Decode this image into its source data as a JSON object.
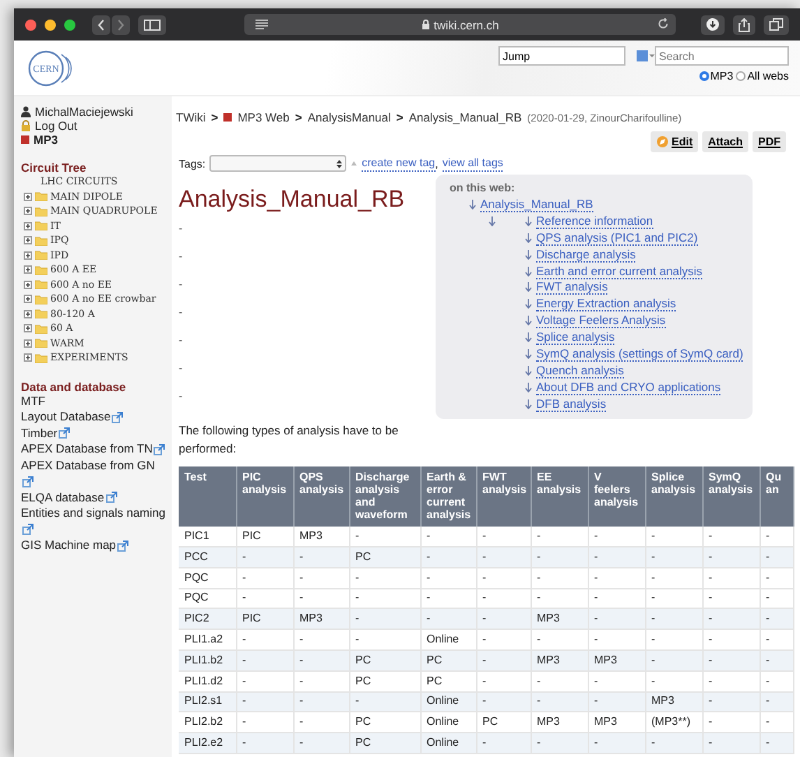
{
  "browser": {
    "url": "twiki.cern.ch"
  },
  "header": {
    "logo_text": "CERN",
    "jump": {
      "value": "Jump"
    },
    "search": {
      "placeholder": "Search"
    },
    "scopes": [
      {
        "label": "MP3",
        "selected": true
      },
      {
        "label": "All webs",
        "selected": false
      }
    ]
  },
  "sidebar": {
    "user_links": [
      {
        "label": "MichalMaciejewski",
        "kind": "user"
      },
      {
        "label": "Log Out",
        "kind": "lock"
      },
      {
        "label": "MP3",
        "kind": "web"
      }
    ],
    "circuit_tree": {
      "title": "Circuit Tree",
      "root": {
        "label": "LHC CIRCUITS",
        "children": [
          {
            "label": "MAIN DIPOLE",
            "expanded": false
          },
          {
            "label": "MAIN QUADRUPOLE",
            "expanded": false
          },
          {
            "label": "IT",
            "expanded": false
          },
          {
            "label": "IPQ",
            "expanded": false
          },
          {
            "label": "IPD",
            "expanded": false
          },
          {
            "label": "600 A EE",
            "expanded": false
          },
          {
            "label": "600 A no EE",
            "expanded": false
          },
          {
            "label": "600 A no EE crowbar",
            "expanded": false
          },
          {
            "label": "80-120 A",
            "expanded": false
          },
          {
            "label": "60 A",
            "expanded": false
          },
          {
            "label": "WARM",
            "expanded": false
          },
          {
            "label": "EXPERIMENTS",
            "expanded": false
          }
        ]
      }
    },
    "data_section": {
      "title": "Data and database",
      "links": [
        {
          "label": "MTF",
          "external": false
        },
        {
          "label": "Layout Database",
          "external": true
        },
        {
          "label": "Timber",
          "external": true
        },
        {
          "label": "APEX Database from TN",
          "external": true
        },
        {
          "label": "APEX Database from GN",
          "external": true
        },
        {
          "label": "ELQA database",
          "external": true
        },
        {
          "label": "Entities and signals naming",
          "external": true
        },
        {
          "label": "GIS Machine map",
          "external": true
        }
      ]
    }
  },
  "breadcrumb": {
    "items": [
      "TWiki",
      "MP3 Web",
      "AnalysisManual",
      "Analysis_Manual_RB"
    ],
    "separator": ">",
    "meta": "(2020-01-29, ZinourCharifoulline)"
  },
  "actions": [
    "Edit",
    "Attach",
    "PDF"
  ],
  "tags": {
    "label": "Tags:",
    "links": [
      "create new tag",
      "view all tags"
    ],
    "separator": ","
  },
  "title": "Analysis_Manual_RB",
  "bullets": [
    "-",
    "-",
    "-",
    "-",
    "-",
    "-",
    "-"
  ],
  "toc": {
    "heading": "on this web:",
    "root": "Analysis_Manual_RB",
    "items": [
      "Reference information",
      "QPS analysis (PIC1 and PIC2)",
      "Discharge analysis",
      "Earth and error current analysis",
      "FWT analysis",
      "Energy Extraction analysis",
      "Voltage Feelers Analysis",
      "Splice analysis",
      "SymQ analysis (settings of SymQ card)",
      "Quench analysis",
      "About DFB and CRYO applications",
      "DFB analysis"
    ]
  },
  "intro": "The following types of analysis have to be performed:",
  "table": {
    "columns": [
      "Test",
      "PIC analysis",
      "QPS analysis",
      "Discharge analysis and waveform",
      "Earth & error current analysis",
      "FWT analysis",
      "EE analysis",
      "V feelers analysis",
      "Splice analysis",
      "SymQ analysis",
      "Qu an"
    ],
    "rows": [
      {
        "shaded": false,
        "cells": [
          "PIC1",
          "PIC",
          "MP3",
          "-",
          "-",
          "-",
          "-",
          "-",
          "-",
          "-",
          "-"
        ]
      },
      {
        "shaded": true,
        "cells": [
          "PCC",
          "-",
          "-",
          "PC",
          "-",
          "-",
          "-",
          "-",
          "-",
          "-",
          "-"
        ]
      },
      {
        "shaded": false,
        "cells": [
          "PQC",
          "-",
          "-",
          "-",
          "-",
          "-",
          "-",
          "-",
          "-",
          "-",
          "-"
        ]
      },
      {
        "shaded": false,
        "cells": [
          "PQC",
          "-",
          "-",
          "-",
          "-",
          "-",
          "-",
          "-",
          "-",
          "-",
          "-"
        ]
      },
      {
        "shaded": true,
        "cells": [
          "PIC2",
          "PIC",
          "MP3",
          "-",
          "-",
          "-",
          "MP3",
          "-",
          "-",
          "-",
          "-"
        ]
      },
      {
        "shaded": false,
        "cells": [
          "PLI1.a2",
          "-",
          "-",
          "-",
          "Online",
          "-",
          "-",
          "-",
          "-",
          "-",
          "-"
        ]
      },
      {
        "shaded": true,
        "cells": [
          "PLI1.b2",
          "-",
          "-",
          "PC",
          "PC",
          "-",
          "MP3",
          "MP3",
          "-",
          "-",
          "-"
        ]
      },
      {
        "shaded": false,
        "cells": [
          "PLI1.d2",
          "-",
          "-",
          "PC",
          "PC",
          "-",
          "-",
          "-",
          "-",
          "-",
          "-"
        ]
      },
      {
        "shaded": true,
        "cells": [
          "PLI2.s1",
          "-",
          "-",
          "-",
          "Online",
          "-",
          "-",
          "-",
          "MP3",
          "-",
          "-"
        ]
      },
      {
        "shaded": false,
        "cells": [
          "PLI2.b2",
          "-",
          "-",
          "PC",
          "Online",
          "PC",
          "MP3",
          "MP3",
          "(MP3**)",
          "-",
          "-"
        ]
      },
      {
        "shaded": true,
        "cells": [
          "PLI2.e2",
          "-",
          "-",
          "PC",
          "Online",
          "-",
          "-",
          "-",
          "-",
          "-",
          "-"
        ]
      }
    ]
  }
}
